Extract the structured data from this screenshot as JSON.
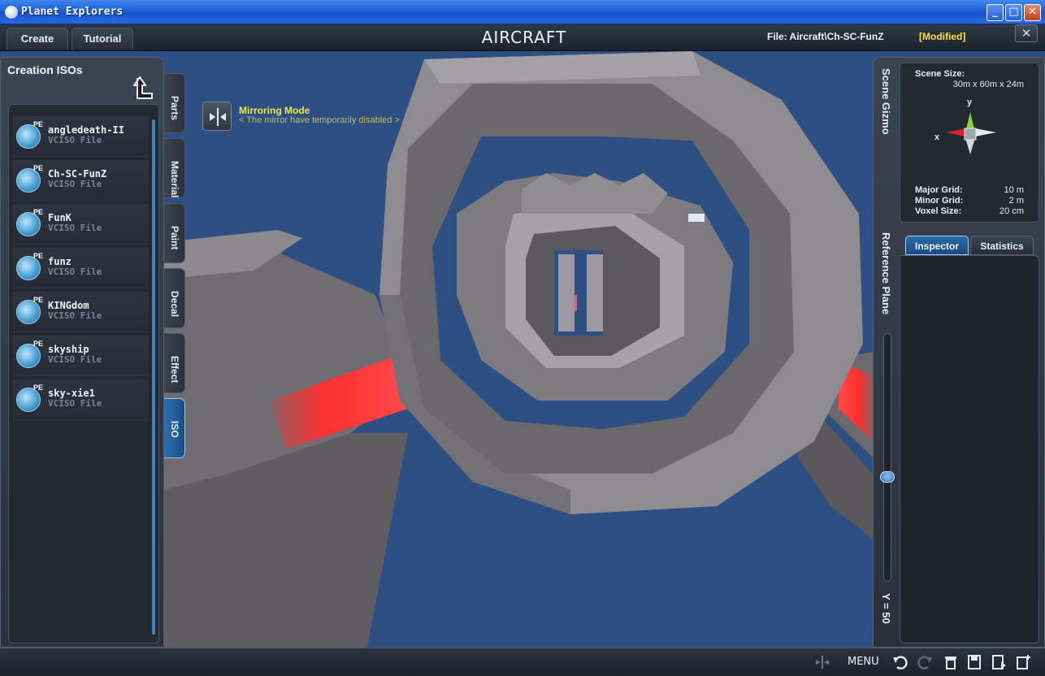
{
  "window": {
    "title": "Planet Explorers",
    "buttons": [
      "_",
      "□",
      "✕"
    ]
  },
  "topbar": {
    "tabs": [
      "Create",
      "Tutorial"
    ],
    "mode_title": "AIRCRAFT",
    "file_label": "File:  Aircraft\\Ch-SC-FunZ",
    "modified": "[Modified]",
    "close_symbol": "✕"
  },
  "left_panel": {
    "title": "Creation ISOs",
    "items": [
      {
        "name": "angledeath-II",
        "type": "VCISO File"
      },
      {
        "name": "Ch-SC-FunZ",
        "type": "VCISO File"
      },
      {
        "name": "FunK",
        "type": "VCISO File"
      },
      {
        "name": "funz",
        "type": "VCISO File"
      },
      {
        "name": "KINGdom",
        "type": "VCISO File"
      },
      {
        "name": "skyship",
        "type": "VCISO File"
      },
      {
        "name": "sky-xie1",
        "type": "VCISO File"
      }
    ],
    "icon_badge": "PE"
  },
  "vertical_tabs": [
    "Parts",
    "Material",
    "Paint",
    "Decal",
    "Effect",
    "ISO"
  ],
  "active_vertical_tab": "ISO",
  "mirroring": {
    "title": "Mirroring Mode",
    "subtitle": "< The mirror have temporarily disabled >"
  },
  "right_panel": {
    "scene_gizmo_label": "Scene Gizmo",
    "scene_size_label": "Scene Size:",
    "scene_size_value": "30m x 60m x 24m",
    "axis_x": "x",
    "axis_y": "y",
    "major_grid_label": "Major Grid:",
    "major_grid_value": "10 m",
    "minor_grid_label": "Minor Grid:",
    "minor_grid_value": "2 m",
    "voxel_size_label": "Voxel Size:",
    "voxel_size_value": "20 cm",
    "reference_plane_label": "Reference Plane",
    "reference_y": "Y = 50",
    "tabs": [
      "Inspector",
      "Statistics"
    ]
  },
  "bottombar": {
    "menu_label": "MENU"
  },
  "colors": {
    "viewport_bg": "#2d4f82",
    "accent_yellow": "#f3e64a",
    "active_tab": "#2b6ca8",
    "hull_gray": "#8c8a8e",
    "engine_red": "#ff3b3b"
  }
}
